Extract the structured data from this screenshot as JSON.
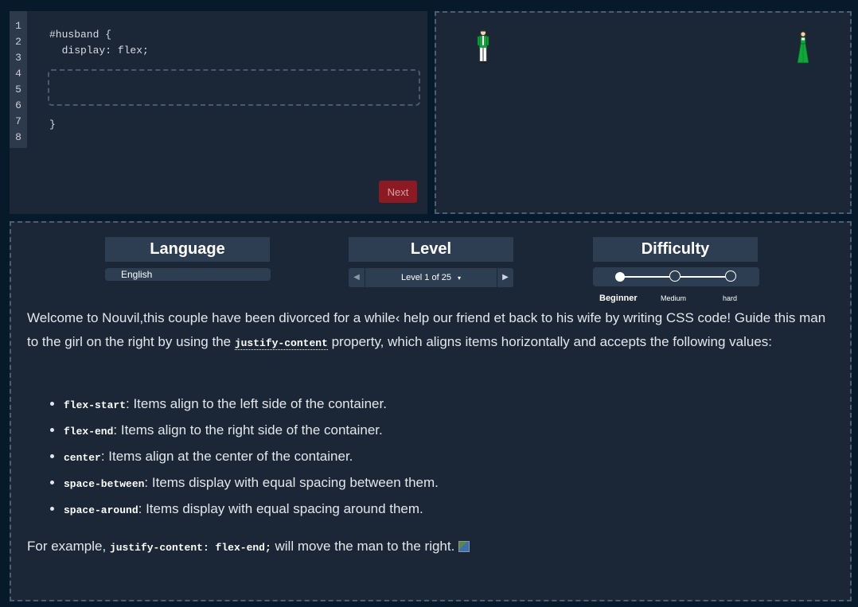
{
  "editor": {
    "line_numbers": [
      "1",
      "2",
      "3",
      "4",
      "5",
      "6",
      "7",
      "8"
    ],
    "code_line_1": "#husband {",
    "code_line_2": "  display: flex;",
    "code_line_closing": "}",
    "input_value": "",
    "next_label": "Next"
  },
  "board": {
    "man_icon": "man-figure-icon",
    "woman_icon": "woman-figure-icon",
    "colors": {
      "dress": "#0fa73a",
      "jacket": "#13a33b",
      "pants": "#ffffff"
    }
  },
  "settings": {
    "language_title": "Language",
    "language_value": "English",
    "level_title": "Level",
    "level_value": "Level 1 of 25",
    "level_caret": "▾",
    "prev_arrow": "◀",
    "next_arrow": "▶",
    "difficulty_title": "Difficulty",
    "difficulty_options": [
      "Beginner",
      "Medium",
      "hard"
    ],
    "difficulty_selected": "Beginner"
  },
  "instructions": {
    "intro_part1": "Welcome to Nouvil,this couple have been divorced for a while‹ help our friend et back to his wife by writing CSS code! Guide this man to the girl on the right by using the ",
    "intro_code": "justify-content",
    "intro_part2": " property, which aligns items horizontally and accepts the following values:",
    "items": [
      {
        "code": "flex-start",
        "text": ": Items align to the left side of the container."
      },
      {
        "code": "flex-end",
        "text": ": Items align to the right side of the container."
      },
      {
        "code": "center",
        "text": ": Items align at the center of the container."
      },
      {
        "code": "space-between",
        "text": ": Items display with equal spacing between them."
      },
      {
        "code": "space-around",
        "text": ": Items display with equal spacing around them."
      }
    ],
    "example_part1": "For example, ",
    "example_code": "justify-content: flex-end;",
    "example_part2": " will move the man to the right."
  },
  "accent_colors": {
    "next_button": "#8b1a22",
    "panel_bg": "#1b2636",
    "page_bg": "#071a2c"
  }
}
